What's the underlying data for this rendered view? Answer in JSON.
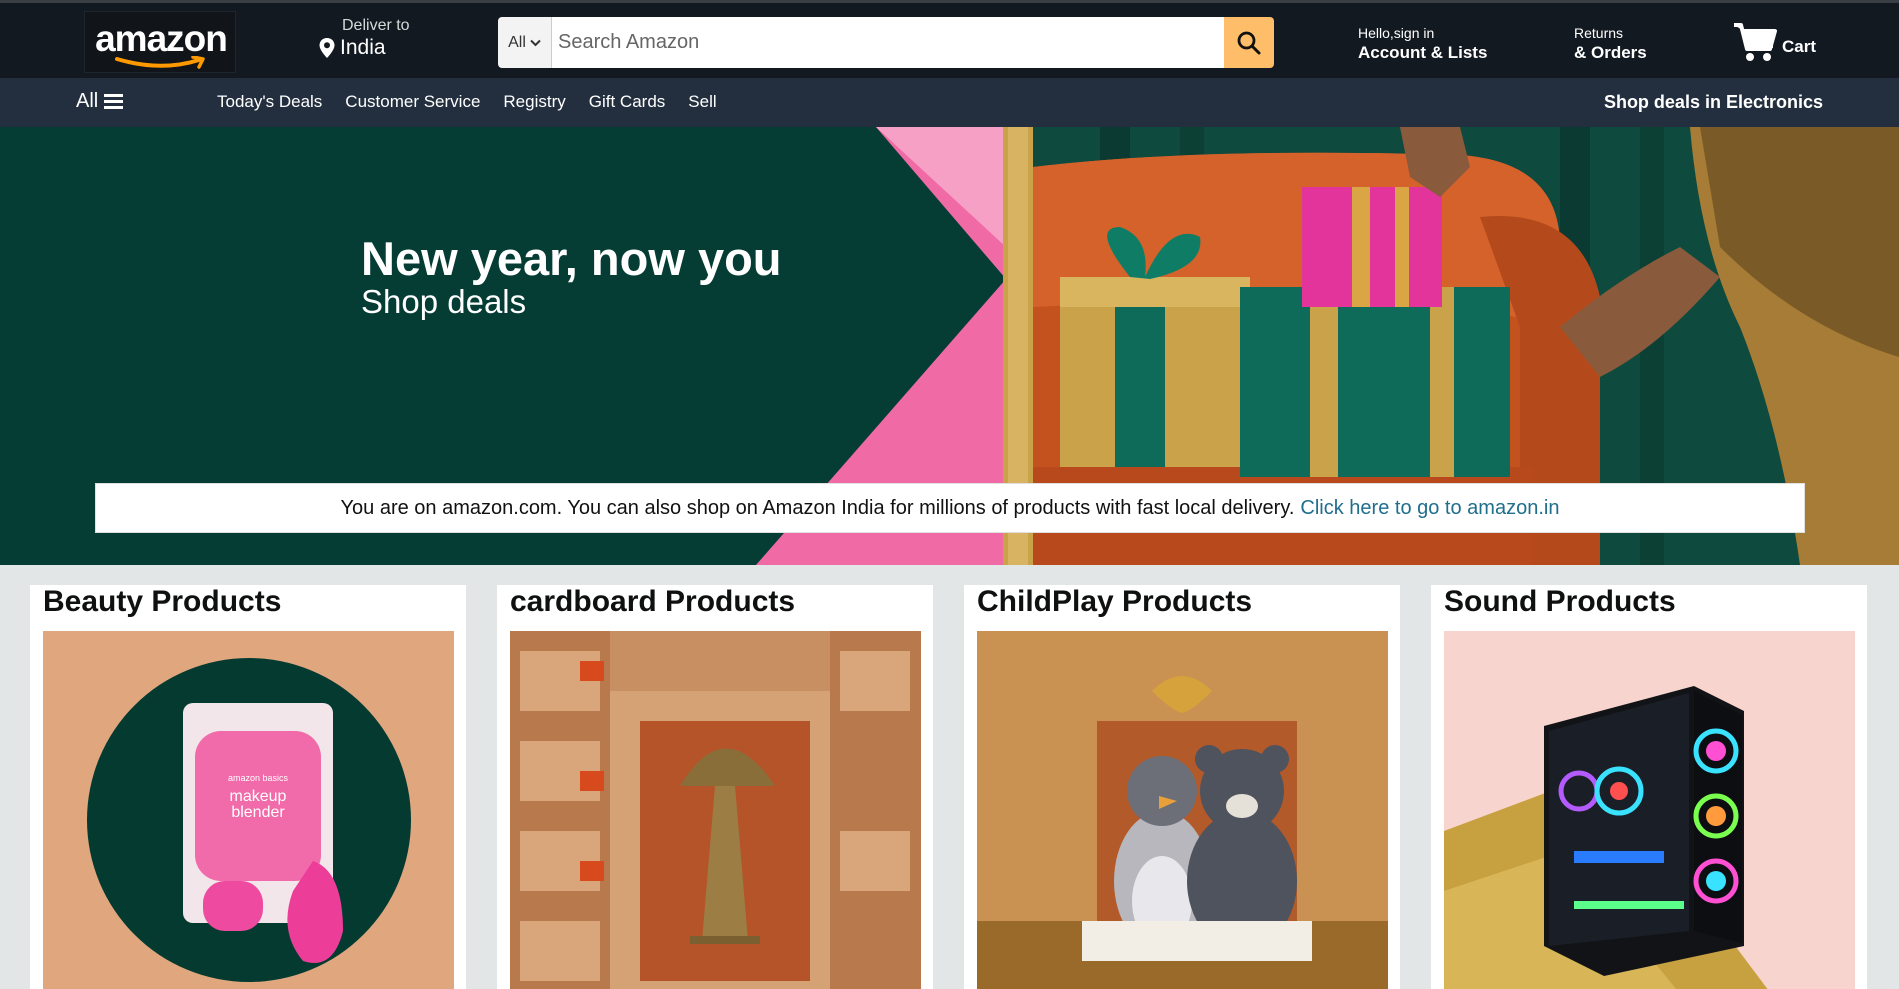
{
  "header": {
    "logo_text": "amazon",
    "deliver_to_label": "Deliver to",
    "deliver_to_location": "India",
    "search_category": "All",
    "search_placeholder": "Search Amazon",
    "account_greeting": "Hello,sign in",
    "account_label": "Account & Lists",
    "returns_label": "Returns",
    "orders_label": "& Orders",
    "cart_label": "Cart"
  },
  "subnav": {
    "all_label": "All",
    "links": [
      "Today's Deals",
      "Customer Service",
      "Registry",
      "Gift Cards",
      "Sell"
    ],
    "promo": "Shop deals in Electronics"
  },
  "hero": {
    "title": "New year, now you",
    "subtitle": "Shop deals"
  },
  "notice": {
    "text": "You are on amazon.com. You can also shop on Amazon India for millions of products with fast local delivery.",
    "link": "Click here to go to amazon.in"
  },
  "cards": [
    {
      "title": "Beauty Products",
      "image_label_line1": "makeup",
      "image_label_line2": "blender",
      "image_brand": "amazon basics"
    },
    {
      "title": "cardboard Products"
    },
    {
      "title": "ChildPlay Products"
    },
    {
      "title": "Sound Products"
    }
  ],
  "colors": {
    "nav_dark": "#131921",
    "nav_sub": "#232f3e",
    "search_button": "#febd69",
    "hero_green": "#053d35",
    "hero_pink": "#f06aa6",
    "link_teal": "#1f6e8c"
  }
}
